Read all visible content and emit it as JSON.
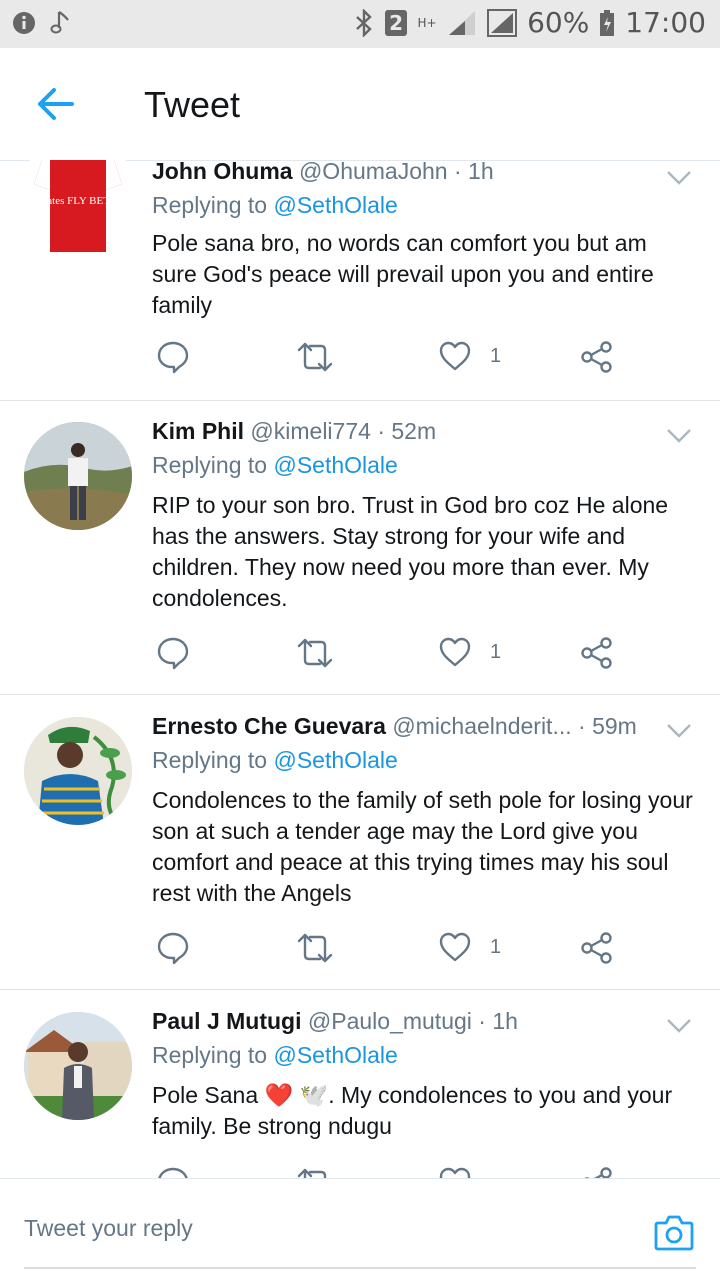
{
  "status_bar": {
    "battery": "60%",
    "time": "17:00",
    "sim": "2",
    "network": "H+"
  },
  "header": {
    "title": "Tweet"
  },
  "tweets": [
    {
      "name": "John Ohuma",
      "handle": "@OhumaJohn",
      "time": "· 1h",
      "replying_prefix": "Replying to",
      "replying_to": "@SethOlale",
      "text": "Pole sana bro, no words can comfort you but am sure God's peace will prevail upon you and entire family",
      "likes": "1",
      "avatar_text": "Emirates FLY BETTER"
    },
    {
      "name": "Kim Phil",
      "handle": "@kimeli774",
      "time": "· 52m",
      "replying_prefix": "Replying to",
      "replying_to": "@SethOlale",
      "text": "RIP to your son bro. Trust in God bro coz He alone has the answers. Stay strong for your wife and children. They now need you more than ever. My condolences.",
      "likes": "1"
    },
    {
      "name": "Ernesto Che Guevara",
      "handle": "@michaelnderit...",
      "time": "· 59m",
      "replying_prefix": "Replying to",
      "replying_to": "@SethOlale",
      "text": "Condolences to the family of seth pole for losing your son at such a tender age may the Lord give you comfort and peace at this trying times may his soul rest with the Angels",
      "likes": "1"
    },
    {
      "name": "Paul J Mutugi",
      "handle": "@Paulo_mutugi",
      "time": "· 1h",
      "replying_prefix": "Replying to",
      "replying_to": "@SethOlale",
      "text": "Pole Sana ❤️ 🕊️. My condolences to you and your family. Be strong ndugu",
      "likes": ""
    }
  ],
  "composer": {
    "placeholder": "Tweet your reply"
  },
  "colors": {
    "accent": "#1da1f2",
    "link": "#1b95e0",
    "muted": "#657786",
    "text": "#14171a"
  },
  "icons": {
    "back": "arrow-left-icon",
    "chevron": "chevron-down-icon",
    "reply": "reply-bubble-icon",
    "retweet": "retweet-icon",
    "like": "heart-icon",
    "share": "share-icon",
    "camera": "camera-icon"
  }
}
